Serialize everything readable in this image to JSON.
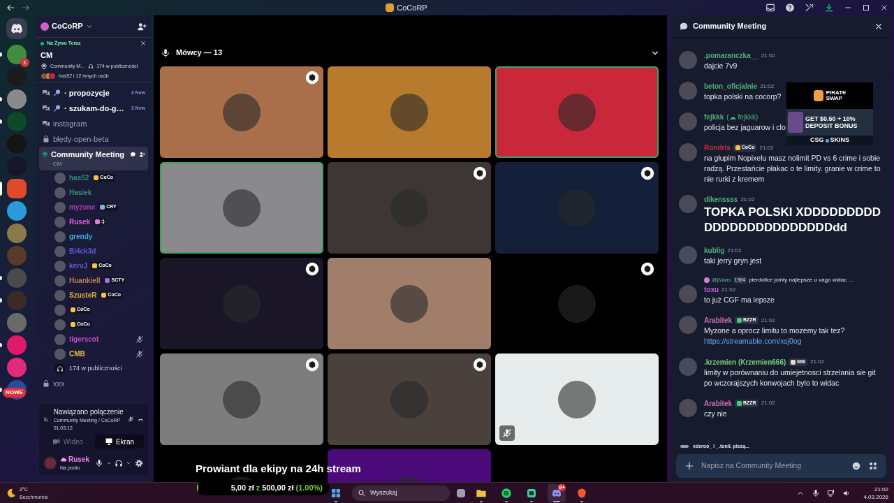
{
  "titlebar": {
    "title": "CoCoRP"
  },
  "servers": [
    {
      "color": "#3f8f3f",
      "unread": true,
      "selected": false,
      "badge": "1"
    },
    {
      "color": "#1b1b1b",
      "unread": false,
      "selected": false
    },
    {
      "color": "#8a8a8a",
      "unread": true,
      "selected": false
    },
    {
      "color": "#0c4a2a",
      "unread": true,
      "selected": false
    },
    {
      "color": "#151515",
      "unread": false,
      "selected": false
    },
    {
      "color": "#161628",
      "unread": false,
      "selected": false
    },
    {
      "color": "#e04a2a",
      "unread": false,
      "selected": true
    },
    {
      "color": "#2a9ad8",
      "unread": false,
      "selected": false
    },
    {
      "color": "#8a7a4a",
      "unread": false,
      "selected": false
    },
    {
      "color": "#5a3a2a",
      "unread": false,
      "selected": false
    },
    {
      "color": "#4a4a4a",
      "unread": true,
      "selected": false
    },
    {
      "color": "#3a2a2a",
      "unread": true,
      "selected": false
    },
    {
      "color": "#6a6a6a",
      "unread": false,
      "selected": false
    },
    {
      "color": "#e01a6a",
      "unread": true,
      "selected": false
    },
    {
      "color": "#e02a7a",
      "unread": false,
      "selected": false
    },
    {
      "color": "#2a4a9a",
      "unread": true,
      "selected": false
    }
  ],
  "new_badge": "NOWE",
  "server": {
    "name": "CoCoRP"
  },
  "live": {
    "label": "Na Żywo Teraz",
    "title": "CM",
    "channel": "Community M…",
    "audience": "174 w publiczności",
    "people": "has52 i 12 innych osób"
  },
  "channels": [
    {
      "kind": "forum",
      "name": "· propozycje",
      "unread": true,
      "selected": false,
      "badge": "3 New"
    },
    {
      "kind": "forum",
      "name": "· szukam-do-g…",
      "unread": true,
      "selected": false,
      "badge": "3 New"
    },
    {
      "kind": "forum",
      "name": "instagram",
      "unread": false,
      "selected": false
    },
    {
      "kind": "locked",
      "name": "błędy-open-beta",
      "unread": false,
      "selected": false
    },
    {
      "kind": "stage",
      "name": "Community Meeting",
      "topic": "CM",
      "unread": true,
      "selected": true,
      "audience": "174 w publiczności",
      "children": [
        {
          "name": "has52",
          "color": "#3b8a7a",
          "tag": {
            "text": "CoCo",
            "color": "#f5c542"
          },
          "muted": false
        },
        {
          "name": "Hasiek",
          "color": "#3b8a7a",
          "muted": false
        },
        {
          "name": "myzone",
          "color": "#b03ab0",
          "tag": {
            "text": "CRY",
            "color": "#7ab8e0"
          },
          "muted": false
        },
        {
          "name": "Rusek",
          "color": "#e060e0",
          "tag": {
            "text": ":)",
            "color": "#e07ad8"
          },
          "muted": false
        },
        {
          "name": "grendy",
          "color": "#3ab0e0",
          "muted": false
        },
        {
          "name": "Bl4ck3d",
          "color": "#5a5ad0",
          "muted": false
        },
        {
          "name": "kervJ",
          "color": "#6a5ad0",
          "tag": {
            "text": "CoCo",
            "color": "#f5c542"
          },
          "muted": false
        },
        {
          "name": "Huankiell",
          "color": "#c07a5a",
          "tag": {
            "text": "SCTY",
            "color": "#a070e0"
          },
          "muted": false
        },
        {
          "name": "SzusteR",
          "color": "#e0b030",
          "tag": {
            "text": "CoCo",
            "color": "#f5c542"
          },
          "muted": false
        },
        {
          "tag": {
            "text": "CoCo",
            "color": "#f5c542"
          },
          "muted": false
        },
        {
          "tag": {
            "text": "CoCo",
            "color": "#f5c542"
          },
          "muted": false
        },
        {
          "name": "tigerscot",
          "color": "#c050c0",
          "muted": true
        },
        {
          "name": "CMB",
          "color": "#e0c040",
          "muted": true
        }
      ]
    },
    {
      "kind": "locked",
      "name": "xxx",
      "unread": false,
      "selected": false
    }
  ],
  "voice": {
    "status": "Nawiązano połączenie",
    "location": "Community Meeting / CoCoRP",
    "elapsed": "01:03:12",
    "video": {
      "label": "Wideo",
      "disabled": true
    },
    "screen": {
      "label": "Ekran",
      "disabled": false
    }
  },
  "user": {
    "name": "Rusek",
    "status": "Na podiu"
  },
  "stage": {
    "header": "Mówcy — 13",
    "tiles": [
      {
        "color": "#a86f4a",
        "speaking": false,
        "badge": true,
        "muted": false
      },
      {
        "color": "#b87a2c",
        "speaking": false,
        "badge": false,
        "muted": false
      },
      {
        "color": "#c8283a",
        "speaking": true,
        "badge": false,
        "muted": false
      },
      {
        "color": "#8a8a8e",
        "speaking": true,
        "badge": false,
        "muted": false
      },
      {
        "color": "#3d3635",
        "speaking": false,
        "badge": true,
        "muted": false
      },
      {
        "color": "#14203a",
        "speaking": false,
        "badge": true,
        "muted": false
      },
      {
        "color": "#1a1628",
        "speaking": false,
        "badge": true,
        "muted": false
      },
      {
        "color": "#a07e6a",
        "speaking": false,
        "badge": false,
        "muted": false
      },
      {
        "color": "#000000",
        "speaking": false,
        "badge": true,
        "muted": false
      },
      {
        "color": "#7d7d7d",
        "speaking": false,
        "badge": true,
        "muted": false
      },
      {
        "color": "#4a403c",
        "speaking": false,
        "badge": true,
        "muted": false
      },
      {
        "color": "#e7edec",
        "speaking": false,
        "badge": false,
        "muted": true
      },
      {
        "color": "#000000",
        "speaking": false,
        "badge": false,
        "muted": false
      },
      {
        "color": "#4a0a7a",
        "speaking": false,
        "badge": false,
        "muted": false
      }
    ]
  },
  "overlay": {
    "title": "Prowiant dla ekipy na 24h stream",
    "raised": "5,00 zł",
    "separator": "z",
    "goal": "500,00 zł",
    "percent": "(1.00%)",
    "level": 0.01
  },
  "ad": {
    "brand_top": "PIRATE",
    "brand_bottom": "SWAP",
    "offer_top": "GET $0.50 + 10%",
    "offer_bottom": "DEPOSIT BONUS",
    "sponsor_left": "CSG",
    "sponsor_right": "SKINS"
  },
  "chat": {
    "title": "Community Meeting",
    "messages": [
      {
        "kind": "text",
        "author": ".pomaranczka__",
        "color": "#4fb07a",
        "time": "21:02",
        "text": "dajcie 7v9"
      },
      {
        "kind": "text",
        "author": "beton_oficjalnie",
        "color": "#4fb07a",
        "time": "21:02",
        "text": "topka polski na cocorp?"
      },
      {
        "kind": "text",
        "author": "fejkkk",
        "alias": "(☁ fejkkk)",
        "color": "#4fb07a",
        "text": "policja bez jaguarow i clo"
      },
      {
        "kind": "text",
        "author": "Rondris",
        "color": "#c8323c",
        "tags": [
          {
            "text": "CoCo",
            "color": "#f5c542"
          }
        ],
        "time": "21:02",
        "text": "na głupim Nopixelu masz nolimit PD vs 6 crime i sobie radzą. Przestańcie płakac o te limity. granie w crime to nie rurki z kremem"
      },
      {
        "kind": "big",
        "author": "dikenssss",
        "color": "#4fb07a",
        "time": "21:02",
        "text": "TOPKA POLSKI XDDDDDDDDDDDDDDDDDDDDDDDDdd"
      },
      {
        "kind": "text",
        "author": "kublig",
        "color": "#4fb07a",
        "time": "21:02",
        "text": "taki jerry gryn jest"
      },
      {
        "kind": "text",
        "author": "toxu",
        "color": "#c060e0",
        "reply": {
          "author": "@jVaas",
          "tag": "1984",
          "text": "pierdolice jointy najlepsze u vago widac ..."
        },
        "time": "21:02",
        "text": "to już CGF ma lepsze"
      },
      {
        "kind": "text",
        "author": "Arabitek",
        "color": "#d070b0",
        "tags": [
          {
            "text": "BZZR",
            "color": "#3ad07a"
          }
        ],
        "time": "21:02",
        "text": "Myzone a oprocz limitu to mozemy tak tez?",
        "link": "https://streamable.com/xsj0og"
      },
      {
        "kind": "text",
        "author": ".krzemien (Krzemien666)",
        "color": "#7ad07a",
        "tags": [
          {
            "text": "666",
            "color": "#dddddd"
          }
        ],
        "time": "21:02",
        "text": "limity w porównaniu do umiejetnosci strzelania sie git po wczorajszych konwojach bylo to widac"
      },
      {
        "kind": "text",
        "author": "Arabitek",
        "color": "#d070b0",
        "tags": [
          {
            "text": "BZZR",
            "color": "#3ad07a"
          }
        ],
        "time": "21:02",
        "text": "czy nie"
      }
    ],
    "typing": "xderoo_ i _.tonii. piszą...",
    "placeholder": "Napisz na Community Meeting"
  },
  "taskbar": {
    "weather": {
      "temp": "2°C",
      "desc": "Bezchmurnie"
    },
    "search": "Wyszukaj",
    "apps": [
      {
        "kind": "windows",
        "selected": false
      },
      {
        "kind": "folder",
        "selected": false
      },
      {
        "kind": "spotify",
        "selected": false
      },
      {
        "kind": "app",
        "selected": false
      },
      {
        "kind": "discord",
        "selected": true,
        "badge": "9+"
      },
      {
        "kind": "brave",
        "selected": false
      }
    ],
    "time": "21:02",
    "date": "4.03.2026"
  }
}
